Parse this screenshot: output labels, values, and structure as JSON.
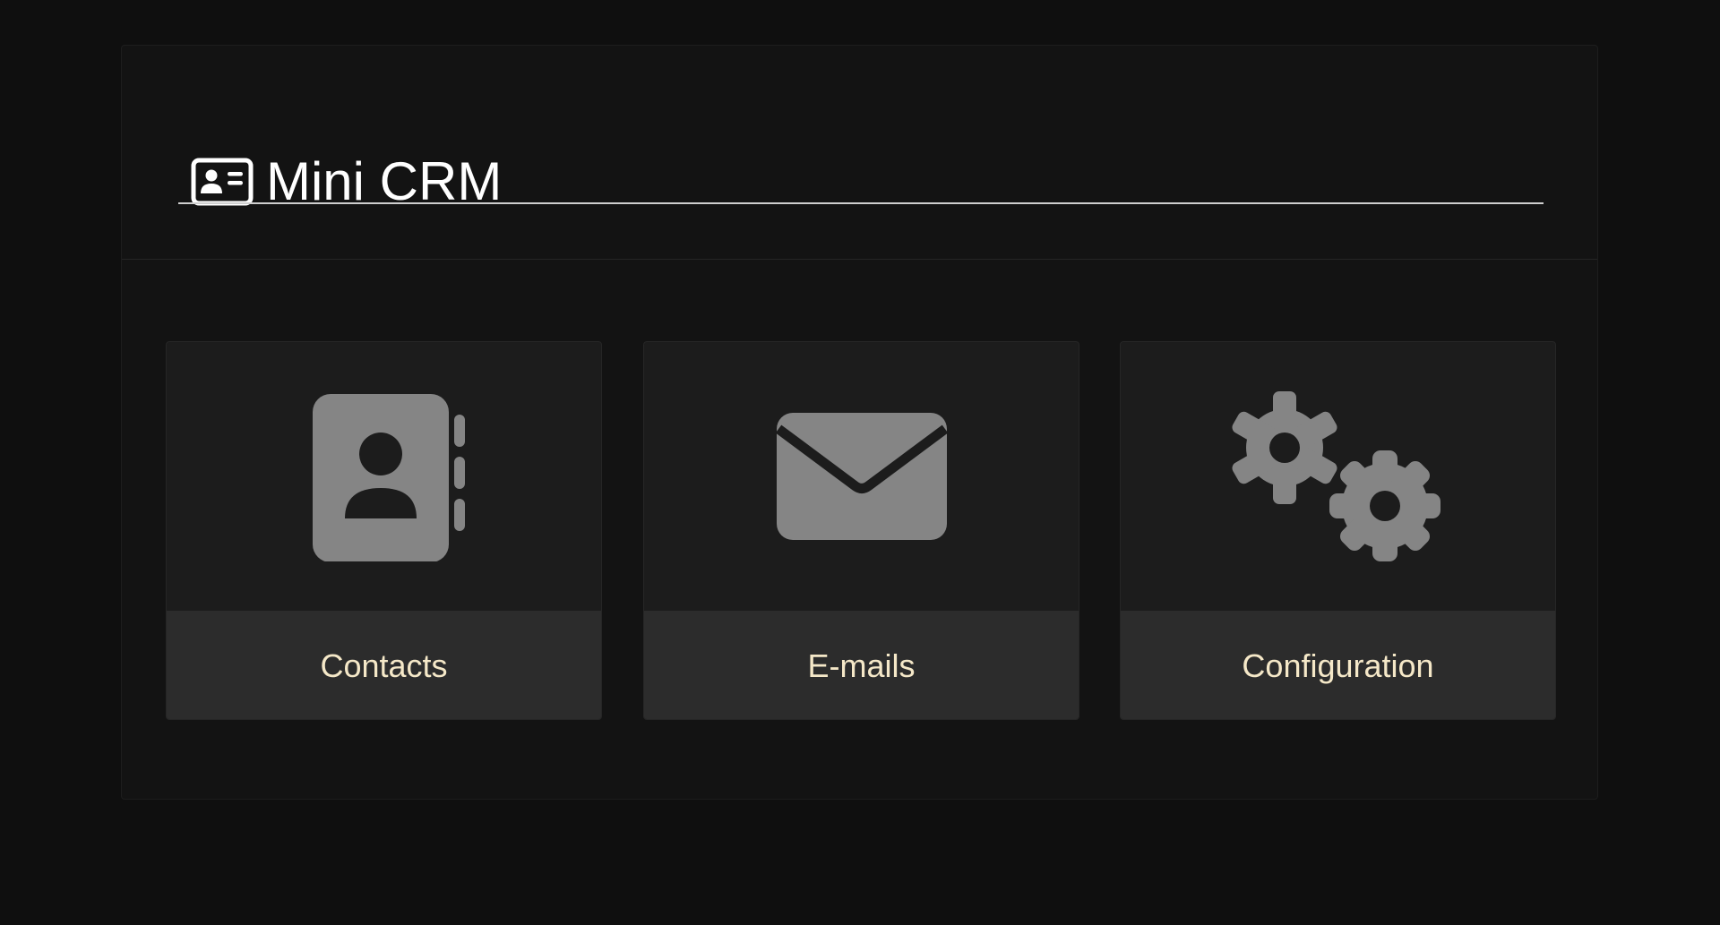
{
  "header": {
    "title": "Mini CRM",
    "icon": "id-card-icon"
  },
  "tiles": [
    {
      "label": "Contacts",
      "icon": "address-book-icon"
    },
    {
      "label": "E-mails",
      "icon": "envelope-icon"
    },
    {
      "label": "Configuration",
      "icon": "gears-icon"
    }
  ],
  "colors": {
    "page_background": "#0f0f0f",
    "panel_background": "#131313",
    "tile_background": "#1c1c1c",
    "tile_footer_background": "#2c2c2c",
    "tile_label": "#f5e8c8",
    "icon_fill": "#858585",
    "title_text": "#ffffff"
  }
}
